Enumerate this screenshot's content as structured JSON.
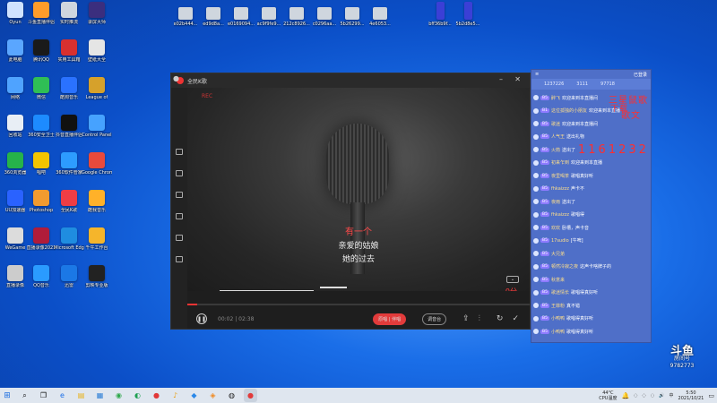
{
  "desktop": {
    "icons": [
      {
        "label": "Oyun",
        "color": "#cfe3ff"
      },
      {
        "label": "斗鱼直播伴侣",
        "color": "#ff9c2a"
      },
      {
        "label": "实时推流",
        "color": "#cfd6de"
      },
      {
        "label": "录屏大师",
        "color": "#3b2e7e"
      },
      {
        "label": "此电脑",
        "color": "#5aa6ff"
      },
      {
        "label": "腾讯QQ",
        "color": "#1a1a1a"
      },
      {
        "label": "实用工具箱",
        "color": "#d8302f"
      },
      {
        "label": "壁纸大全",
        "color": "#e5e5e5"
      },
      {
        "label": "网络",
        "color": "#4fa3ff"
      },
      {
        "label": "微信",
        "color": "#2fbf55"
      },
      {
        "label": "酷狗音乐",
        "color": "#2a72ff"
      },
      {
        "label": "League of",
        "color": "#d6a12b"
      },
      {
        "label": "回收站",
        "color": "#e8eef5"
      },
      {
        "label": "360安全卫士",
        "color": "#1d8bff"
      },
      {
        "label": "抖音直播伴侣",
        "color": "#111111"
      },
      {
        "label": "Control Panel",
        "color": "#46a2ff"
      },
      {
        "label": "360浏览器",
        "color": "#26b34a"
      },
      {
        "label": "唱吧",
        "color": "#f2c400"
      },
      {
        "label": "360软件管家",
        "color": "#2d9cff"
      },
      {
        "label": "Google Chrome",
        "color": "#e84a3c"
      },
      {
        "label": "UU加速器",
        "color": "#2a62ff"
      },
      {
        "label": "Photoshop",
        "color": "#f29b2f"
      },
      {
        "label": "全民K歌",
        "color": "#ef3d45"
      },
      {
        "label": "酷我音乐",
        "color": "#ffb129"
      },
      {
        "label": "WeGame",
        "color": "#dcdcdc"
      },
      {
        "label": "直播录像2021",
        "color": "#b01c3a"
      },
      {
        "label": "Microsoft Edge",
        "color": "#1f8de0"
      },
      {
        "label": "千牛工作台",
        "color": "#f5b52b"
      },
      {
        "label": "直播录像",
        "color": "#cccccc"
      },
      {
        "label": "QQ音乐",
        "color": "#2a9bff"
      },
      {
        "label": "迅雷",
        "color": "#1b78e6"
      },
      {
        "label": "剪映专业版",
        "color": "#222"
      }
    ],
    "top_files": [
      "e02b444...",
      "ed9d8a...",
      "e0169094...",
      "ac9f9fe9...",
      "212c8926...",
      "c0296aa...",
      "5b26299...",
      "4e6053..."
    ],
    "top_files_right": [
      "bff36b9f...",
      "5b2d8e5..."
    ]
  },
  "player": {
    "title": "全民K歌",
    "rec_label": "REC",
    "lyrics": [
      "有一个",
      "亲爱的姑娘",
      "她的过去"
    ],
    "score_text": "0分",
    "time_current": "00:02",
    "time_total": "02:38",
    "original_label": "原唱",
    "accompaniment_label": "伴唱",
    "mode_label": "调音台",
    "progress_percent": 3
  },
  "live_panel": {
    "login_label": "已登录",
    "user_count": "1237226",
    "fans": "3111",
    "heat": "97718",
    "overlay_text_1": "三星鼠歌",
    "overlay_text_2": "下载",
    "overlay_text_3": "歌文",
    "overlay_number": "1161232",
    "chat": [
      {
        "name": "B5",
        "nick": "醉飞",
        "msg": "欢迎来到本直播间"
      },
      {
        "name": "B1",
        "nick": "这位孤独的小朋友",
        "msg": "欢迎来到本直播"
      },
      {
        "name": "B5",
        "nick": "歌迷",
        "msg": "欢迎来到本直播间"
      },
      {
        "name": "B5",
        "nick": "人气王",
        "msg": "送出礼物"
      },
      {
        "name": "B5",
        "nick": "火箭",
        "msg": "送出了"
      },
      {
        "name": "B5",
        "nick": "初来乍到",
        "msg": "欢迎来到本直播"
      },
      {
        "name": "B5",
        "nick": "夜里喝茶",
        "msg": "歌唱真好听"
      },
      {
        "name": "B5",
        "nick": "fhkaizzz",
        "msg": "声卡不"
      },
      {
        "name": "B5",
        "nick": "夜雨",
        "msg": "送出了"
      },
      {
        "name": "B5",
        "nick": "fhkaizzz",
        "msg": "歌唱得"
      },
      {
        "name": "B5",
        "nick": "欢欢",
        "msg": "卧槽，声卡音"
      },
      {
        "name": "B5",
        "nick": "17sudio",
        "msg": "[牛啤]"
      },
      {
        "name": "B5",
        "nick": "大兄弟",
        "msg": ""
      },
      {
        "name": "B5",
        "nick": "顿然冷寂之夜",
        "msg": "这声卡啥牌子的"
      },
      {
        "name": "B5",
        "nick": "秋意来",
        "msg": ""
      },
      {
        "name": "B5",
        "nick": "歌迷情长",
        "msg": "歌唱得真好听"
      },
      {
        "name": "B5",
        "nick": "王菲粉",
        "msg": "真不错"
      },
      {
        "name": "B5",
        "nick": "小鸭鸭",
        "msg": "歌唱得真好听"
      },
      {
        "name": "B5",
        "nick": "小鸭鸭",
        "msg": "歌唱得真好听"
      }
    ]
  },
  "douyu": {
    "logo": "斗鱼",
    "sub": "房间号",
    "room": "9782773"
  },
  "taskbar": {
    "weather_temp": "44°C",
    "weather_label": "CPU温度",
    "time": "5:50",
    "date": "2021/10/21",
    "lang": "中"
  }
}
